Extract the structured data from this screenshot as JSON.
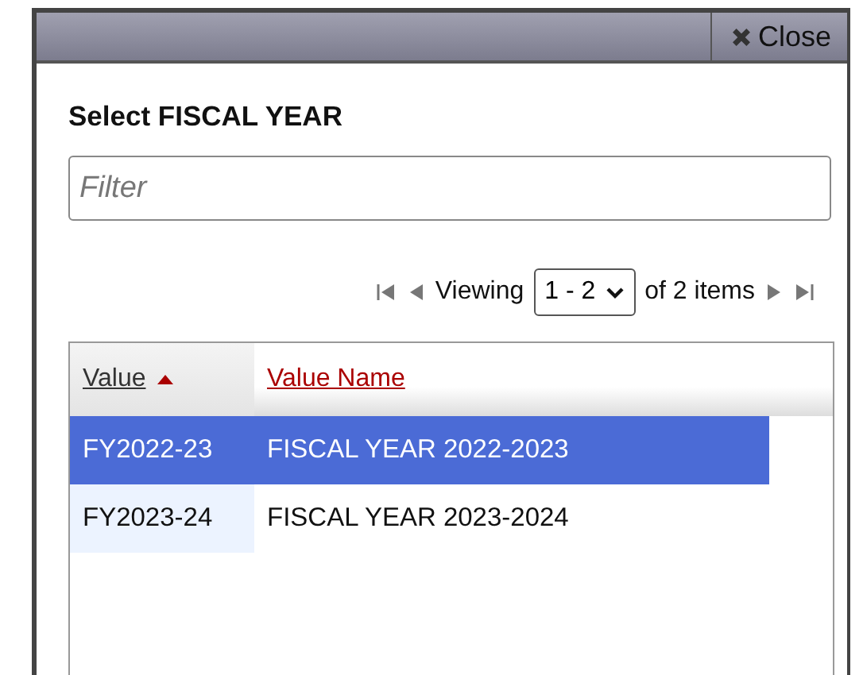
{
  "dialog": {
    "close_label": "Close",
    "heading": "Select FISCAL YEAR"
  },
  "filter": {
    "placeholder": "Filter"
  },
  "pager": {
    "prefix": "Viewing",
    "range": "1 - 2",
    "suffix": "of 2 items"
  },
  "table": {
    "columns": [
      {
        "label": "Value",
        "sorted": true
      },
      {
        "label": "Value Name",
        "sorted": false
      }
    ],
    "rows": [
      {
        "cells": [
          "FY2022-23",
          "FISCAL YEAR 2022-2023"
        ],
        "selected": true
      },
      {
        "cells": [
          "FY2023-24",
          "FISCAL YEAR 2023-2024"
        ],
        "selected": false
      }
    ]
  }
}
